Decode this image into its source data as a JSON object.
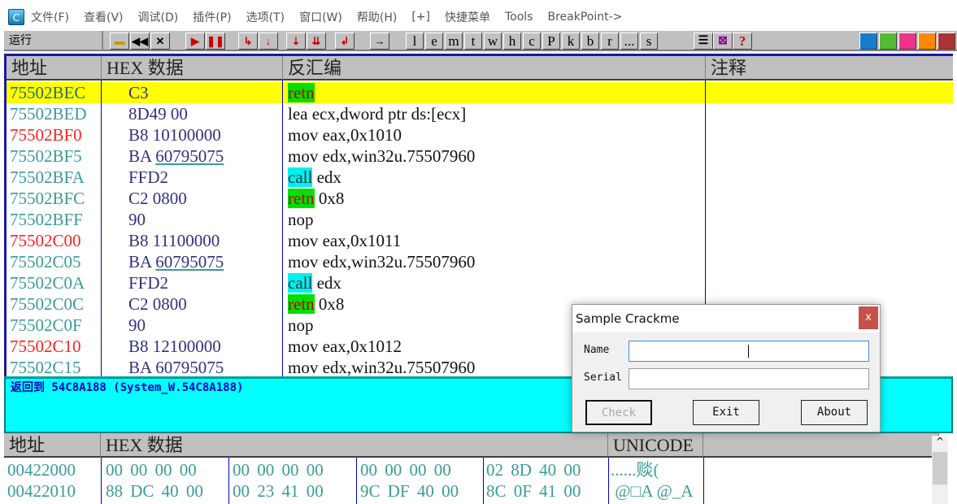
{
  "menu": [
    "文件(F)",
    "查看(V)",
    "调试(D)",
    "插件(P)",
    "选项(T)",
    "窗口(W)",
    "帮助(H)",
    "[+]",
    "快捷菜单",
    "Tools",
    "BreakPoint->"
  ],
  "app_icon": "C",
  "toolbar": {
    "status": "运行",
    "letters": [
      "l",
      "e",
      "m",
      "t",
      "w",
      "h",
      "c",
      "P",
      "k",
      "b",
      "r",
      "...",
      "s"
    ],
    "help": "?"
  },
  "cpu": {
    "headers": {
      "address": "地址",
      "hex": "HEX 数据",
      "disasm": "反汇编",
      "comment": "注释"
    },
    "rows": [
      {
        "addr": "75502BEC",
        "hex": "C3",
        "mn": "retn",
        "ops": "",
        "hl": "green",
        "addr_color": "#2a6a6a",
        "selected": true
      },
      {
        "addr": "75502BED",
        "hex": "8D49 00",
        "mn": "lea",
        "ops": " ecx,dword ptr ds:[ecx]",
        "hl": "",
        "addr_color": "#3a9a9a"
      },
      {
        "addr": "75502BF0",
        "hex": "B8 10100000",
        "mn": "mov",
        "ops": " eax,0x1010",
        "hl": "",
        "addr_color": "#ff2020"
      },
      {
        "addr": "75502BF5",
        "hex": "BA ",
        "hex_link": "60795075",
        "mn": "mov",
        "ops": " edx,win32u.75507960",
        "hl": "",
        "addr_color": "#3a9a9a"
      },
      {
        "addr": "75502BFA",
        "hex": "FFD2",
        "mn": "call",
        "ops": " edx",
        "hl": "cyan",
        "addr_color": "#3a9a9a"
      },
      {
        "addr": "75502BFC",
        "hex": "C2 0800",
        "mn": "retn",
        "ops": " 0x8",
        "hl": "green",
        "addr_color": "#3a9a9a"
      },
      {
        "addr": "75502BFF",
        "hex": "90",
        "mn": "nop",
        "ops": "",
        "hl": "",
        "addr_color": "#3a9a9a"
      },
      {
        "addr": "75502C00",
        "hex": "B8 11100000",
        "mn": "mov",
        "ops": " eax,0x1011",
        "hl": "",
        "addr_color": "#ff2020"
      },
      {
        "addr": "75502C05",
        "hex": "BA ",
        "hex_link": "60795075",
        "mn": "mov",
        "ops": " edx,win32u.75507960",
        "hl": "",
        "addr_color": "#3a9a9a"
      },
      {
        "addr": "75502C0A",
        "hex": "FFD2",
        "mn": "call",
        "ops": " edx",
        "hl": "cyan",
        "addr_color": "#3a9a9a"
      },
      {
        "addr": "75502C0C",
        "hex": "C2 0800",
        "mn": "retn",
        "ops": " 0x8",
        "hl": "green",
        "addr_color": "#3a9a9a"
      },
      {
        "addr": "75502C0F",
        "hex": "90",
        "mn": "nop",
        "ops": "",
        "hl": "",
        "addr_color": "#3a9a9a"
      },
      {
        "addr": "75502C10",
        "hex": "B8 12100000",
        "mn": "mov",
        "ops": " eax,0x1012",
        "hl": "",
        "addr_color": "#ff2020"
      },
      {
        "addr": "75502C15",
        "hex": "BA 60795075",
        "mn": "mov",
        "ops": " edx,win32u.75507960",
        "hl": "",
        "addr_color": "#3a9a9a"
      }
    ]
  },
  "info": {
    "text": "返回到 54C8A188 (System_W.54C8A188)"
  },
  "dump": {
    "headers": {
      "address": "地址",
      "hex": "HEX 数据",
      "unicode": "UNICODE"
    },
    "rows": [
      {
        "addr": "00422000",
        "g": [
          "00 00 00 00",
          "00 00 00 00",
          "00 00 00 00",
          "02 8D 40 00"
        ],
        "uni": "......赕("
      },
      {
        "addr": "00422010",
        "g": [
          "88 DC 40 00",
          "00 23 41 00",
          "9C DF 40 00",
          "8C 0F 41 00"
        ],
        "uni": " @□A @_A"
      }
    ]
  },
  "dialog": {
    "title": "Sample Crackme",
    "close": "x",
    "name_label": "Name",
    "serial_label": "Serial",
    "name_value": "",
    "serial_value": "",
    "check": "Check",
    "exit": "Exit",
    "about": "About"
  }
}
